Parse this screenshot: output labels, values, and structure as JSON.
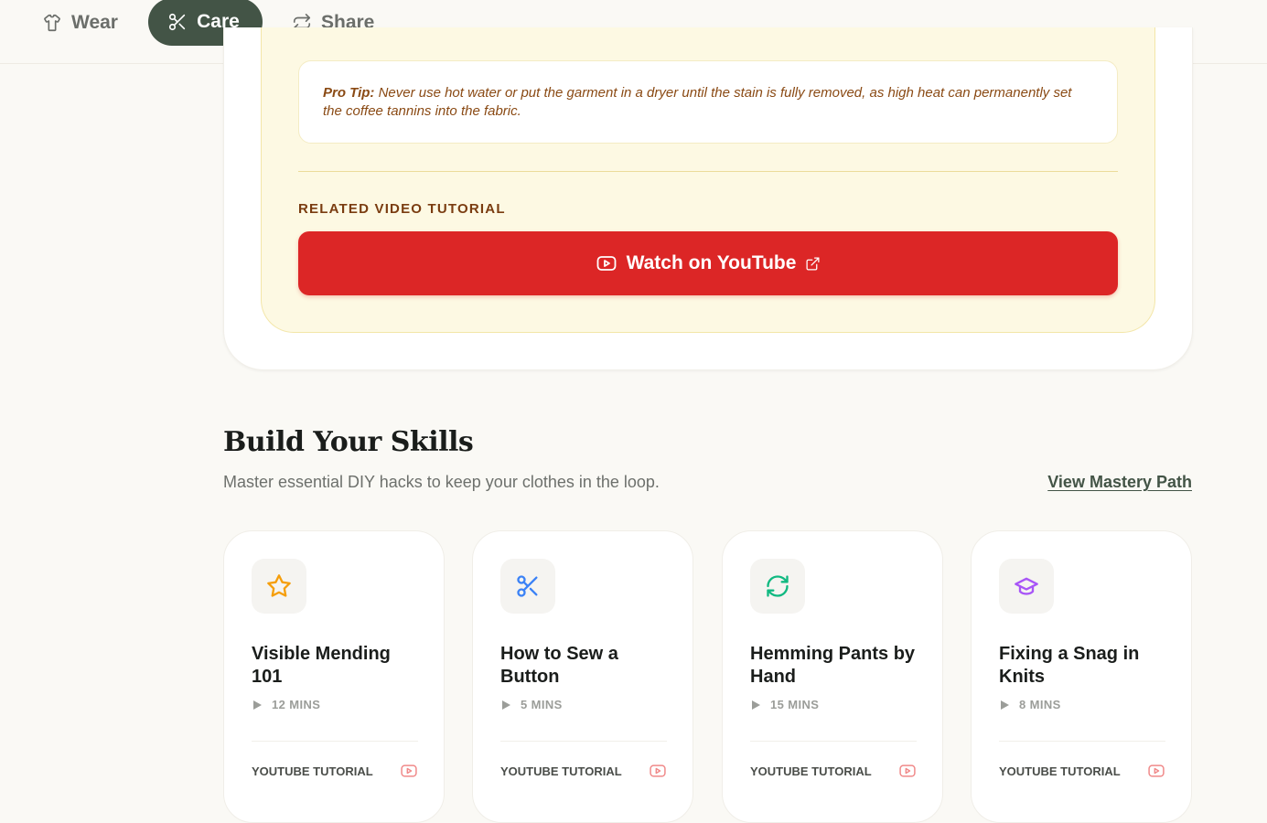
{
  "nav": {
    "wear": "Wear",
    "care": "Care",
    "share": "Share",
    "active_color": "#435446"
  },
  "tip": {
    "label": "Pro Tip:",
    "text": "Never use hot water or put the garment in a dryer until the stain is fully removed, as high heat can permanently set the coffee tannins into the fabric."
  },
  "related": {
    "label": "RELATED VIDEO TUTORIAL",
    "button": "Watch on YouTube",
    "button_color": "#dc2626"
  },
  "skills": {
    "title": "Build Your Skills",
    "subtitle": "Master essential DIY hacks to keep your clothes in the loop.",
    "link": "View Mastery Path",
    "cards": [
      {
        "title": "Visible Mending 101",
        "duration": "12 MINS",
        "footer": "YOUTUBE TUTORIAL",
        "icon": "star-icon",
        "icon_color": "#f59e0b"
      },
      {
        "title": "How to Sew a Button",
        "duration": "5 MINS",
        "footer": "YOUTUBE TUTORIAL",
        "icon": "scissors-icon",
        "icon_color": "#3b82f6"
      },
      {
        "title": "Hemming Pants by Hand",
        "duration": "15 MINS",
        "footer": "YOUTUBE TUTORIAL",
        "icon": "refresh-icon",
        "icon_color": "#10b981"
      },
      {
        "title": "Fixing a Snag in Knits",
        "duration": "8 MINS",
        "footer": "YOUTUBE TUTORIAL",
        "icon": "graduation-cap-icon",
        "icon_color": "#a855f7"
      }
    ]
  }
}
